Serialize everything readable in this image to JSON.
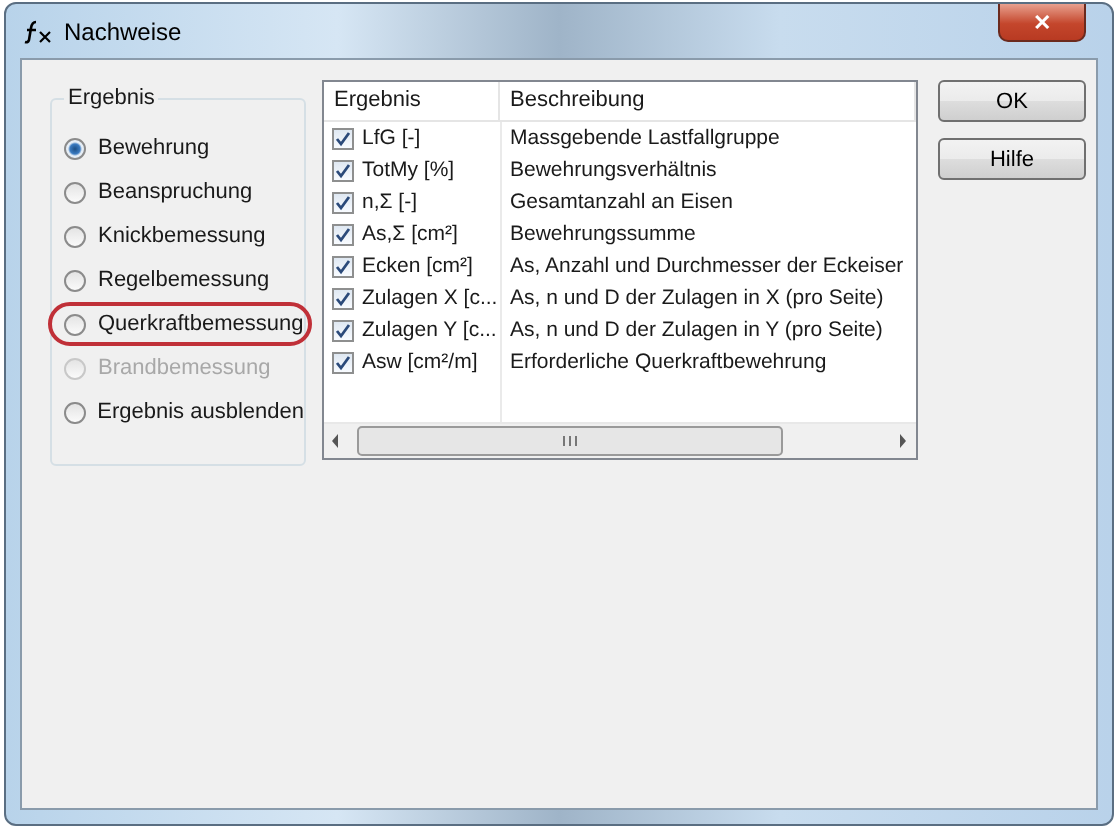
{
  "window": {
    "title": "Nachweise",
    "close": "✕"
  },
  "group": {
    "title": "Ergebnis",
    "options": [
      {
        "label": "Bewehrung",
        "selected": true,
        "disabled": false,
        "highlighted": false
      },
      {
        "label": "Beanspruchung",
        "selected": false,
        "disabled": false,
        "highlighted": false
      },
      {
        "label": "Knickbemessung",
        "selected": false,
        "disabled": false,
        "highlighted": false
      },
      {
        "label": "Regelbemessung",
        "selected": false,
        "disabled": false,
        "highlighted": false
      },
      {
        "label": "Querkraftbemessung",
        "selected": false,
        "disabled": false,
        "highlighted": true
      },
      {
        "label": "Brandbemessung",
        "selected": false,
        "disabled": true,
        "highlighted": false
      },
      {
        "label": "Ergebnis ausblenden",
        "selected": false,
        "disabled": false,
        "highlighted": false
      }
    ]
  },
  "table": {
    "columns": [
      "Ergebnis",
      "Beschreibung"
    ],
    "rows": [
      {
        "name": "LfG [-]",
        "description": "Massgebende Lastfallgruppe",
        "checked": true
      },
      {
        "name": "TotMy [%]",
        "description": "Bewehrungsverhältnis",
        "checked": true
      },
      {
        "name": "n,Σ [-]",
        "description": "Gesamtanzahl an Eisen",
        "checked": true
      },
      {
        "name": "As,Σ [cm²]",
        "description": "Bewehrungssumme",
        "checked": true
      },
      {
        "name": "Ecken [cm²]",
        "description": "As, Anzahl und Durchmesser der Eckeiser",
        "checked": true
      },
      {
        "name": "Zulagen X [c...",
        "description": "As, n und D der Zulagen in X (pro Seite)",
        "checked": true
      },
      {
        "name": "Zulagen Y [c...",
        "description": "As, n und D der Zulagen in Y (pro Seite)",
        "checked": true
      },
      {
        "name": "Asw [cm²/m]",
        "description": "Erforderliche Querkraftbewehrung",
        "checked": true
      }
    ]
  },
  "buttons": [
    "OK",
    "Hilfe"
  ]
}
